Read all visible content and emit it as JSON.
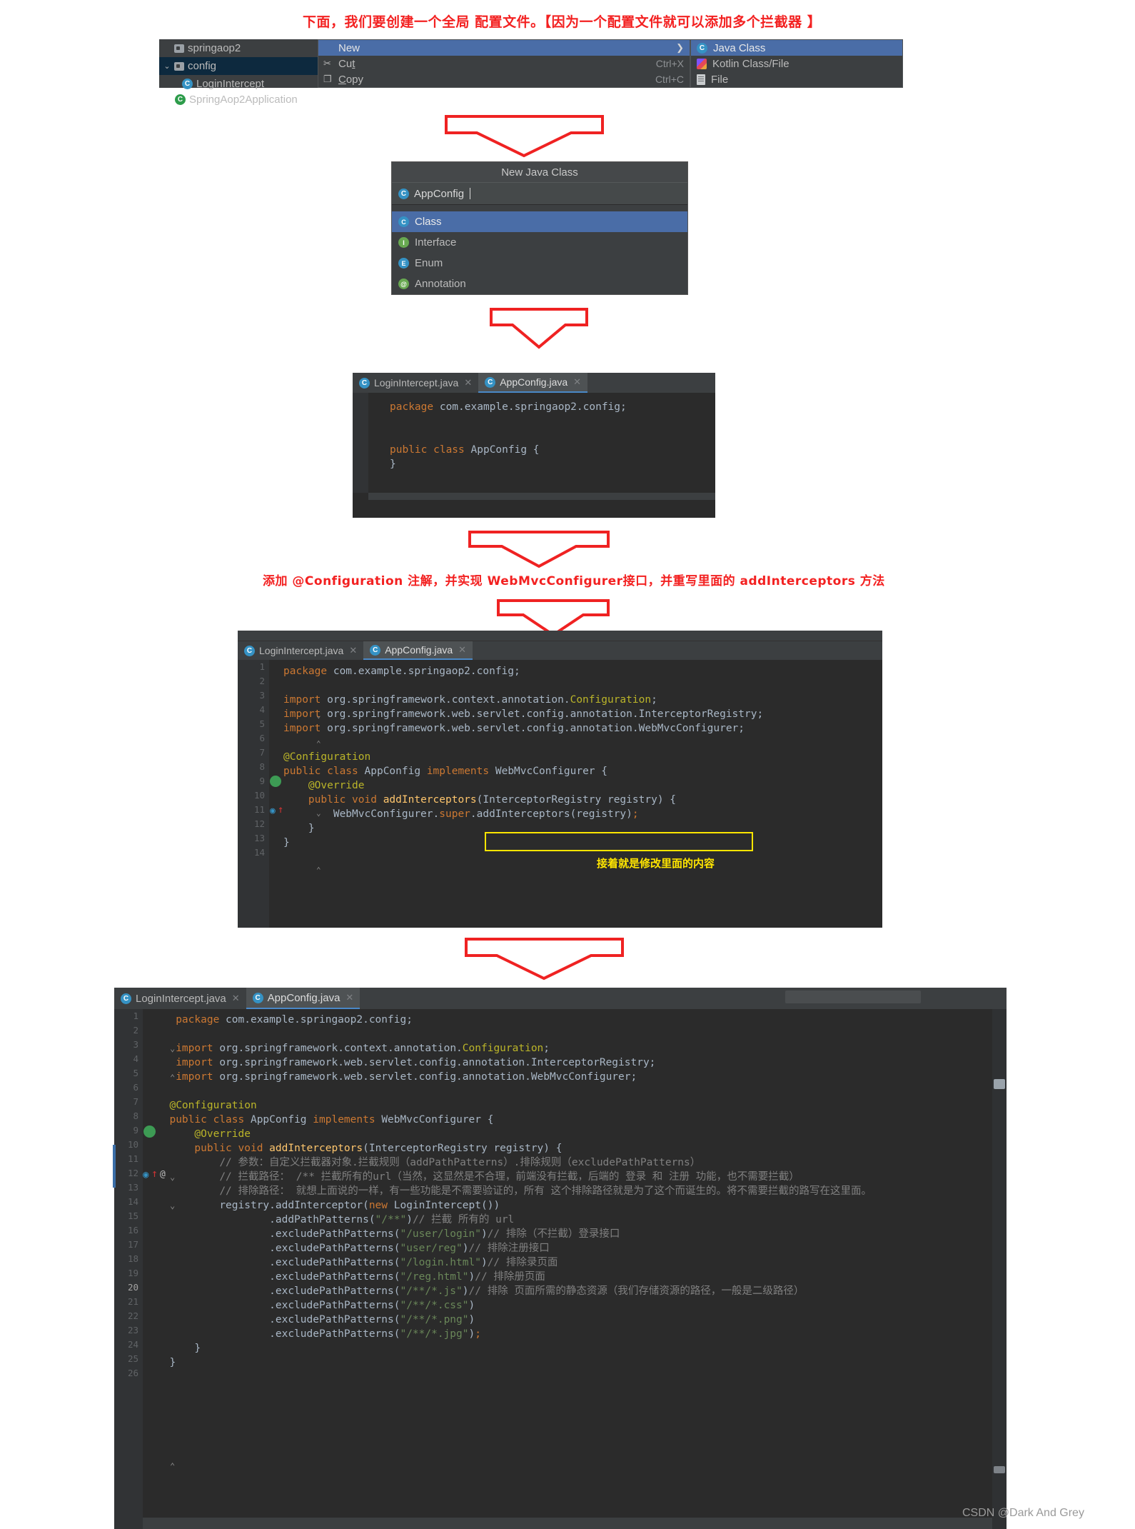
{
  "captions": {
    "top": "下面，我们要创建一个全局 配置文件。【因为一个配置文件就可以添加多个拦截器 】",
    "mid": "添加 @Configuration 注解，并实现 WebMvcConfigurer接口，并重写里面的 addInterceptors 方法",
    "inline_yellow": "接着就是修改里面的内容"
  },
  "project_tree": {
    "items": [
      {
        "label": "springaop2",
        "icon": "folder-icon",
        "selected": false
      },
      {
        "label": "config",
        "icon": "folder-icon",
        "selected": true
      },
      {
        "label": "LoginIntercept",
        "icon": "java-class-icon",
        "selected": false
      },
      {
        "label": "SpringAop2Application",
        "icon": "spring-class-icon",
        "selected": false
      }
    ]
  },
  "context_menu": {
    "items": [
      {
        "label": "New",
        "shortcut": "",
        "icon": "",
        "highlighted": true,
        "has_submenu": true
      },
      {
        "label": "Cut",
        "shortcut": "Ctrl+X",
        "icon": "scissors-icon",
        "highlighted": false,
        "has_submenu": false
      },
      {
        "label": "Copy",
        "shortcut": "Ctrl+C",
        "icon": "copy-icon",
        "highlighted": false,
        "has_submenu": false
      }
    ]
  },
  "context_submenu": {
    "items": [
      {
        "label": "Java Class",
        "icon": "java-class-icon",
        "highlighted": true
      },
      {
        "label": "Kotlin Class/File",
        "icon": "kotlin-icon",
        "highlighted": false
      },
      {
        "label": "File",
        "icon": "file-icon",
        "highlighted": false
      }
    ]
  },
  "new_java_class_dialog": {
    "title": "New Java Class",
    "input_value": "AppConfig",
    "options": [
      {
        "label": "Class",
        "icon": "class-icon",
        "glyph": "C",
        "color": "#3592c4",
        "selected": true
      },
      {
        "label": "Interface",
        "icon": "interface-icon",
        "glyph": "I",
        "color": "#68a851",
        "selected": false
      },
      {
        "label": "Enum",
        "icon": "enum-icon",
        "glyph": "E",
        "color": "#3592c4",
        "selected": false
      },
      {
        "label": "Annotation",
        "icon": "annotation-icon",
        "glyph": "@",
        "color": "#68a851",
        "selected": false
      }
    ]
  },
  "editor_simple": {
    "tabs": [
      {
        "label": "LoginIntercept.java",
        "active": false
      },
      {
        "label": "AppConfig.java",
        "active": true
      }
    ],
    "lines": [
      {
        "no": "",
        "text": "package com.example.springaop2.config;"
      },
      {
        "no": "",
        "text": ""
      },
      {
        "no": "",
        "text": "public class AppConfig {"
      },
      {
        "no": "",
        "text": "}"
      }
    ]
  },
  "editor_mid": {
    "tabs": [
      {
        "label": "LoginIntercept.java",
        "active": false
      },
      {
        "label": "AppConfig.java",
        "active": true
      }
    ],
    "line_numbers": [
      "1",
      "2",
      "3",
      "4",
      "5",
      "6",
      "7",
      "8",
      "9",
      "10",
      "11",
      "12",
      "13",
      "14"
    ],
    "lines": [
      "package com.example.springaop2.config;",
      "",
      "import org.springframework.context.annotation.Configuration;",
      "import org.springframework.web.servlet.config.annotation.InterceptorRegistry;",
      "import org.springframework.web.servlet.config.annotation.WebMvcConfigurer;",
      "",
      "@Configuration",
      "public class AppConfig implements WebMvcConfigurer {",
      "    @Override",
      "    public void addInterceptors(InterceptorRegistry registry) {",
      "        WebMvcConfigurer.super.addInterceptors(registry);",
      "    }",
      "}",
      ""
    ]
  },
  "editor_full": {
    "tabs": [
      {
        "label": "LoginIntercept.java",
        "active": false
      },
      {
        "label": "AppConfig.java",
        "active": true
      }
    ],
    "current_line": "20",
    "line_numbers": [
      "1",
      "2",
      "3",
      "4",
      "5",
      "6",
      "7",
      "8",
      "9",
      "10",
      "11",
      "12",
      "13",
      "14",
      "15",
      "16",
      "17",
      "18",
      "19",
      "20",
      "21",
      "22",
      "23",
      "24",
      "25",
      "26"
    ],
    "lines": [
      "package com.example.springaop2.config;",
      "",
      "import org.springframework.context.annotation.Configuration;",
      "import org.springframework.web.servlet.config.annotation.InterceptorRegistry;",
      "import org.springframework.web.servlet.config.annotation.WebMvcConfigurer;",
      "",
      "@Configuration",
      "public class AppConfig implements WebMvcConfigurer {",
      "    @Override",
      "    public void addInterceptors(InterceptorRegistry registry) {",
      "        // 参数：自定义拦截器对象.拦截规则（addPathPatterns）.排除规则（excludePathPatterns）",
      "        // 拦截路径： /** 拦截所有的url（当然，这显然是不合理，前端没有拦截，后端的 登录 和 注册 功能，也不需要拦截）",
      "        // 排除路径： 就想上面说的一样，有一些功能是不需要验证的，所有 这个排除路径就是为了这个而诞生的。将不需要拦截的路写在这里面。",
      "        registry.addInterceptor(new LoginIntercept())",
      "                .addPathPatterns(\"/**\")// 拦截 所有的 url",
      "                .excludePathPatterns(\"/user/login\")// 排除（不拦截）登录接口",
      "                .excludePathPatterns(\"user/reg\")// 排除注册接口",
      "                .excludePathPatterns(\"/login.html\")// 排除录页面",
      "                .excludePathPatterns(\"/reg.html\")// 排除册页面",
      "                .excludePathPatterns(\"/**/*.js\")// 排除 页面所需的静态资源（我们存储资源的路径，一般是二级路径）",
      "                .excludePathPatterns(\"/**/*.css\")",
      "                .excludePathPatterns(\"/**/*.png\")",
      "                .excludePathPatterns(\"/**/*.jpg\");",
      "    }",
      "}",
      ""
    ]
  },
  "watermark": "CSDN @Dark And Grey",
  "colors": {
    "red_caption": "#f32121",
    "yellow_note": "#ffe500",
    "ide_bg": "#2b2b2b",
    "ide_panel": "#3c3f41",
    "accent_blue": "#4a6da7"
  }
}
